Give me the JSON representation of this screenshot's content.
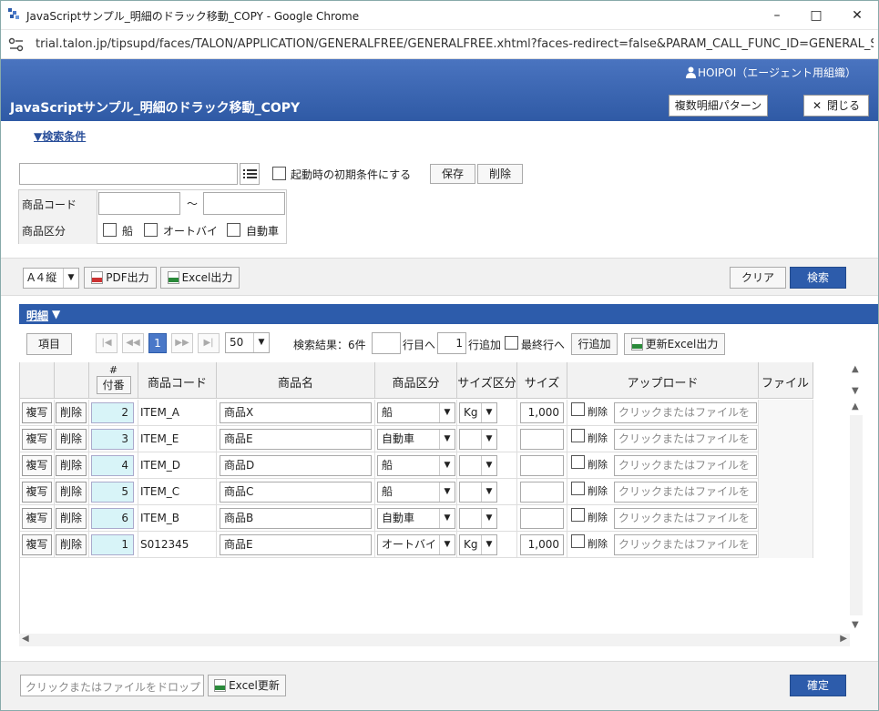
{
  "window": {
    "title": "JavaScriptサンプル_明細のドラック移動_COPY - Google Chrome",
    "minimize": "–",
    "maximize": "□",
    "close": "✕"
  },
  "browser": {
    "url": "trial.talon.jp/tipsupd/faces/TALON/APPLICATION/GENERALFREE/GENERALFREE.xhtml?faces-redirect=false&PARAM_CALL_FUNC_ID=GENERAL_S..."
  },
  "header": {
    "user": "HOIPOI（エージェント用組織）",
    "title": "JavaScriptサンプル_明細のドラック移動_COPY",
    "multi_pattern": "複数明細パターン",
    "close": "閉じる",
    "close_mark": "✕"
  },
  "search": {
    "toggle": "▼検索条件",
    "startup_label": "起動時の初期条件にする",
    "save": "保存",
    "delete": "削除",
    "fields": {
      "product_code_label": "商品コード",
      "range_sep": "～",
      "category_label": "商品区分",
      "categories": [
        "船",
        "オートバイ",
        "自動車"
      ]
    }
  },
  "toolbar": {
    "paper": "A４縦",
    "pdf": "PDF出力",
    "excel": "Excel出力",
    "clear": "クリア",
    "search": "検索"
  },
  "details": {
    "title": "明細",
    "caret": "▼",
    "items_btn": "項目",
    "pages": {
      "first": "|◀",
      "prev": "◀◀",
      "current": "1",
      "next": "▶▶",
      "last": "▶|"
    },
    "page_size": "50",
    "result": "検索結果：6件",
    "goto_suffix": "行目へ",
    "add_count": "1",
    "add_label": "行追加",
    "last_row": "最終行へ",
    "add_row": "行追加",
    "excel_update": "更新Excel出力"
  },
  "grid": {
    "hash": "#",
    "numbering": "付番",
    "columns": [
      "商品コード",
      "商品名",
      "商品区分",
      "サイズ区分",
      "サイズ",
      "アップロード",
      "ファイル"
    ],
    "copy": "複写",
    "del": "削除",
    "upload_del": "削除",
    "upload_ph": "クリックまたはファイルを",
    "rows": [
      {
        "no": "2",
        "code": "ITEM_A",
        "name": "商品X",
        "cat": "船",
        "unit": "Kg",
        "size": "1,000"
      },
      {
        "no": "3",
        "code": "ITEM_E",
        "name": "商品E",
        "cat": "自動車",
        "unit": "",
        "size": ""
      },
      {
        "no": "4",
        "code": "ITEM_D",
        "name": "商品D",
        "cat": "船",
        "unit": "",
        "size": ""
      },
      {
        "no": "5",
        "code": "ITEM_C",
        "name": "商品C",
        "cat": "船",
        "unit": "",
        "size": ""
      },
      {
        "no": "6",
        "code": "ITEM_B",
        "name": "商品B",
        "cat": "自動車",
        "unit": "",
        "size": ""
      },
      {
        "no": "1",
        "code": "S012345",
        "name": "商品E",
        "cat": "オートバイ",
        "unit": "Kg",
        "size": "1,000"
      }
    ]
  },
  "footer": {
    "drop_ph": "クリックまたはファイルをドロップ",
    "excel_update": "Excel更新",
    "confirm": "確定"
  },
  "colors": {
    "header": "#2f5aa5",
    "primary": "#2d5cab",
    "numcell": "#d8f4f8"
  }
}
